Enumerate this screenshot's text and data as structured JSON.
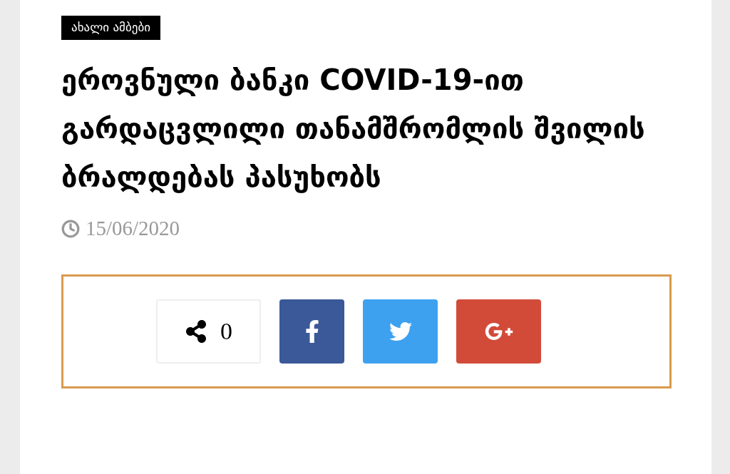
{
  "category": "ახალი ამბები",
  "headline": "ეროვნული ბანკი COVID-19-ით გარდაცვლილი თანამშრომლის შვილის ბრალდებას პასუხობს",
  "date": "15/06/2020",
  "share": {
    "count": "0",
    "buttons": [
      {
        "kind": "facebook",
        "color": "#3b5998"
      },
      {
        "kind": "twitter",
        "color": "#3ea1ef"
      },
      {
        "kind": "googleplus",
        "color": "#d24b38"
      }
    ]
  }
}
